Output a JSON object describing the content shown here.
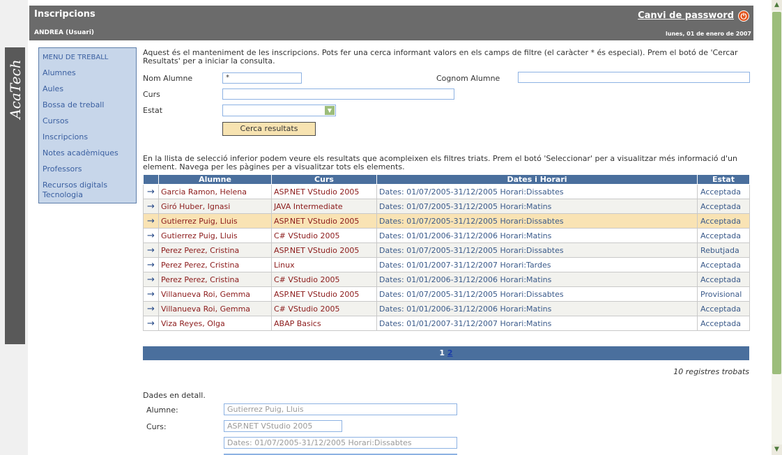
{
  "app": {
    "title": "Inscripcions",
    "user": "ANDREA (Usuari)",
    "change_password": "Canvi de password",
    "date": "lunes, 01 de enero de 2007",
    "brand": "AcaTech"
  },
  "menu": {
    "title": "MENU DE TREBALL",
    "items": [
      "Alumnes",
      "Aules",
      "Bossa de treball",
      "Cursos",
      "Inscripcions",
      "Notes acadèmiques",
      "Professors",
      "Recursos digitals",
      "Tecnologia"
    ]
  },
  "intro": "Aquest és el manteniment de les inscripcions. Pots fer una cerca informant valors en els camps de filtre (el caràcter * és especial). Prem el botó de 'Cercar Resultats' per a iniciar la consulta.",
  "filters": {
    "student_name_label": "Nom Alumne",
    "student_name_value": "*",
    "student_surname_label": "Cognom Alumne",
    "student_surname_value": "",
    "course_label": "Curs",
    "course_value": "",
    "status_label": "Estat",
    "status_value": "",
    "search_button": "Cerca resultats"
  },
  "results_intro": "En la llista de selecció inferior podem veure els resultats que acompleixen els filtres triats. Prem el botó 'Seleccionar' per a visualitzar més informació d'un element. Navega per les pàgines per a visualitzar tots els elements.",
  "table": {
    "headers": [
      "Alumne",
      "Curs",
      "Dates i Horari",
      "Estat"
    ],
    "selected_row": 2,
    "rows": [
      {
        "student": "Garcia Ramon, Helena",
        "course": "ASP.NET VStudio 2005",
        "dates": "Dates: 01/07/2005-31/12/2005 Horari:Dissabtes",
        "status": "Acceptada"
      },
      {
        "student": "Giró Huber, Ignasi",
        "course": "JAVA Intermediate",
        "dates": "Dates: 01/07/2005-31/12/2005 Horari:Matins",
        "status": "Acceptada"
      },
      {
        "student": "Gutierrez Puig, Lluis",
        "course": "ASP.NET VStudio 2005",
        "dates": "Dates: 01/07/2005-31/12/2005 Horari:Dissabtes",
        "status": "Acceptada"
      },
      {
        "student": "Gutierrez Puig, Lluis",
        "course": "C# VStudio 2005",
        "dates": "Dates: 01/01/2006-31/12/2006 Horari:Matins",
        "status": "Acceptada"
      },
      {
        "student": "Perez Perez, Cristina",
        "course": "ASP.NET VStudio 2005",
        "dates": "Dates: 01/07/2005-31/12/2005 Horari:Dissabtes",
        "status": "Rebutjada"
      },
      {
        "student": "Perez Perez, Cristina",
        "course": "Linux",
        "dates": "Dates: 01/01/2007-31/12/2007 Horari:Tardes",
        "status": "Acceptada"
      },
      {
        "student": "Perez Perez, Cristina",
        "course": "C# VStudio 2005",
        "dates": "Dates: 01/01/2006-31/12/2006 Horari:Matins",
        "status": "Acceptada"
      },
      {
        "student": "Villanueva Roi, Gemma",
        "course": "ASP.NET VStudio 2005",
        "dates": "Dates: 01/07/2005-31/12/2005 Horari:Dissabtes",
        "status": "Provisional"
      },
      {
        "student": "Villanueva Roi, Gemma",
        "course": "C# VStudio 2005",
        "dates": "Dates: 01/01/2006-31/12/2006 Horari:Matins",
        "status": "Acceptada"
      },
      {
        "student": "Viza Reyes, Olga",
        "course": "ABAP Basics",
        "dates": "Dates: 01/01/2007-31/12/2007 Horari:Matins",
        "status": "Acceptada"
      }
    ]
  },
  "pager": {
    "current": "1",
    "next": "2"
  },
  "record_count": "10 registres trobats",
  "detail": {
    "title": "Dades en detall.",
    "student_label": "Alumne:",
    "student_value": "Gutierrez Puig, Lluis",
    "course_label": "Curs:",
    "course_value": "ASP.NET VStudio 2005",
    "dates_value": "Dates: 01/07/2005-31/12/2005 Horari:Dissabtes"
  },
  "icons": {
    "row_select": "arrow-right-icon",
    "power": "power-icon",
    "dropdown": "chevron-down-icon"
  },
  "colors": {
    "header_bg": "#6b6b6b",
    "menu_bg": "#c7d6ea",
    "table_header_bg": "#4a6f9d",
    "selected_row_bg": "#f9e3b4",
    "button_bg": "#f7e3b1",
    "scroll_thumb": "#9cbd7b"
  }
}
